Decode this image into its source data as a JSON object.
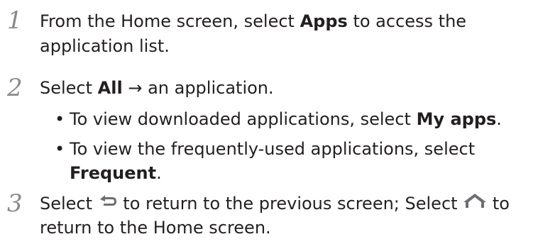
{
  "steps": [
    {
      "number": "1",
      "lines": [
        {
          "pre": "From the Home screen, select ",
          "bold": "Apps",
          "post": " to access the"
        },
        {
          "text": "application list."
        }
      ]
    },
    {
      "number": "2",
      "line": {
        "pre": "Select ",
        "bold": "All",
        "post": " → an application."
      },
      "bullets": [
        {
          "pre": "To view downloaded applications, select ",
          "bold": "My apps",
          "post": "."
        },
        {
          "pre": "To view the frequently-used applications, select",
          "bold2": "Frequent",
          "post2": "."
        }
      ]
    },
    {
      "number": "3",
      "lines": [
        {
          "pre": "Select ",
          "mid": " to return to the previous screen; Select ",
          "post": " to"
        },
        {
          "text": "return to the Home screen."
        }
      ],
      "icons": [
        "back-icon",
        "home-icon"
      ]
    }
  ],
  "colors": {
    "text": "#231f20",
    "step_number": "#8a8a8a",
    "icon": "#6d6e71"
  }
}
